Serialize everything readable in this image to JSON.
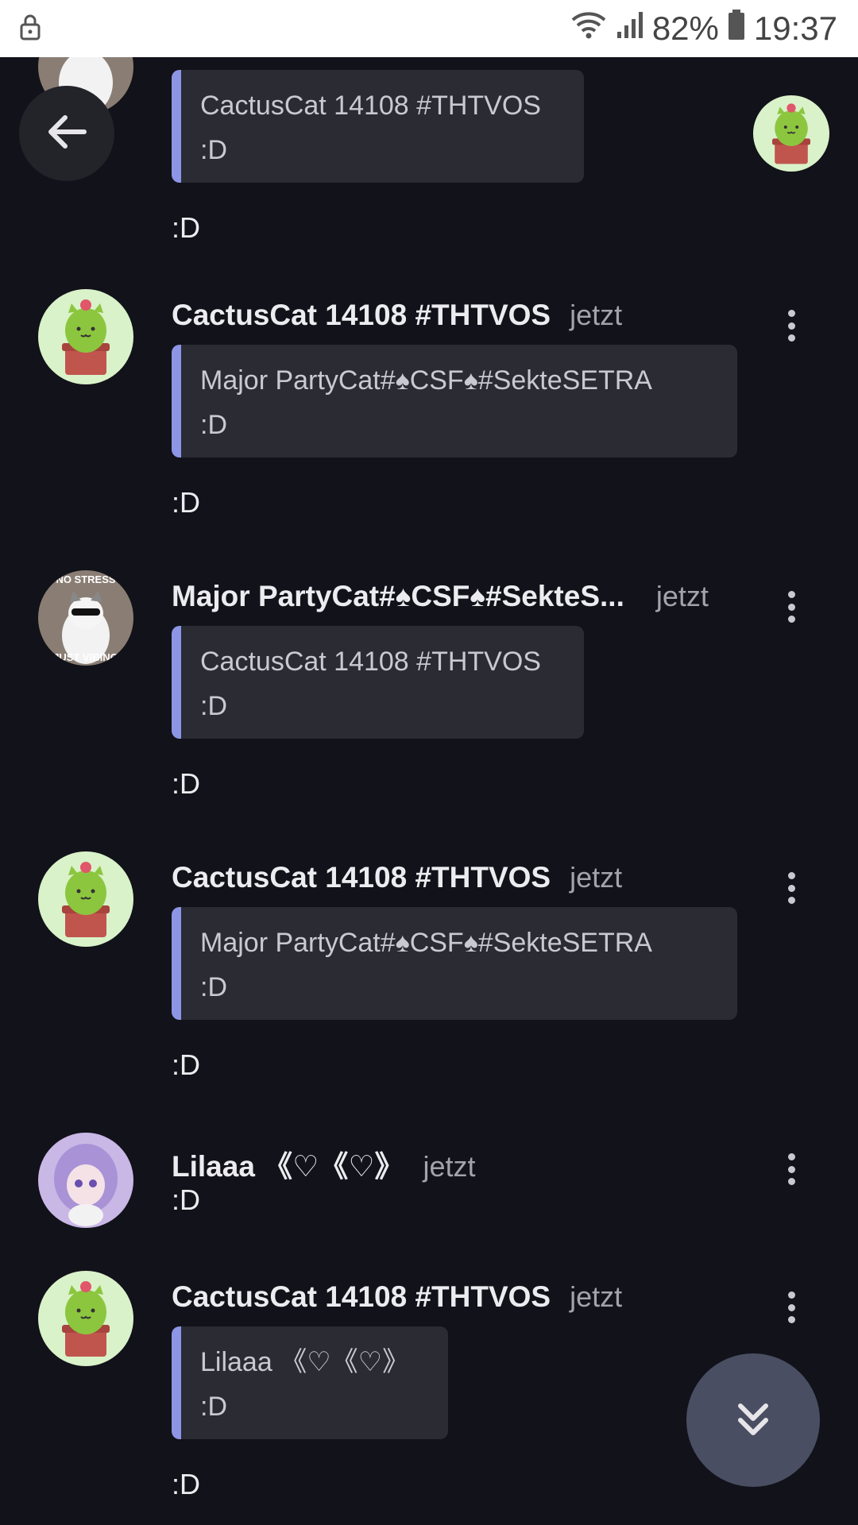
{
  "status_bar": {
    "battery": "82%",
    "time": "19:37",
    "icons": [
      "lock-icon",
      "wifi-icon",
      "signal-icon",
      "battery-icon"
    ]
  },
  "top": {
    "partial_quote": {
      "author": "CactusCat 14108 #THTVOS",
      "text": ":D"
    },
    "partial_body": ":D"
  },
  "messages": [
    {
      "author": "CactusCat 14108 #THTVOS",
      "time": "jetzt",
      "avatar": "cactus-cat-avatar",
      "quote": {
        "author": "Major PartyCat#♠CSF♠#SekteSETRA",
        "text": ":D"
      },
      "body": ":D"
    },
    {
      "author": "Major PartyCat#♠CSF♠#SekteS...",
      "time": "jetzt",
      "avatar": "no-stress-cat-avatar",
      "quote": {
        "author": "CactusCat 14108 #THTVOS",
        "text": ":D"
      },
      "body": ":D"
    },
    {
      "author": "CactusCat 14108 #THTVOS",
      "time": "jetzt",
      "avatar": "cactus-cat-avatar",
      "quote": {
        "author": "Major PartyCat#♠CSF♠#SekteSETRA",
        "text": ":D"
      },
      "body": ":D"
    },
    {
      "author": "Lilaaa 《♡《♡》",
      "time": "jetzt",
      "avatar": "anime-girl-avatar",
      "body": ":D"
    },
    {
      "author": "CactusCat 14108 #THTVOS",
      "time": "jetzt",
      "avatar": "cactus-cat-avatar",
      "quote": {
        "author": "Lilaaa 《♡《♡》",
        "text": ":D"
      },
      "body": ":D"
    }
  ],
  "colors": {
    "background": "#12121a",
    "quote_bg": "#2b2b33",
    "quote_bar": "#8d95e6",
    "fab_down": "#4a4e62"
  }
}
